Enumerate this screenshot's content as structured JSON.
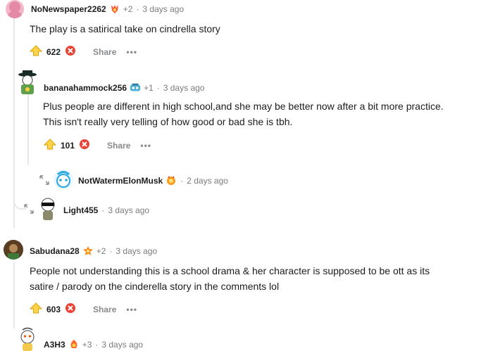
{
  "comments": [
    {
      "username": "NoNewspaper2262",
      "award_count": "+2",
      "time": "3 days ago",
      "body": "The play is a satirical take on cindrella story",
      "votes": "622",
      "share": "Share",
      "more": "•••"
    },
    {
      "username": "bananahammock256",
      "award_count": "+1",
      "time": "3 days ago",
      "body_line1": "Plus people are different in high school,and she may be better now after a bit more practice.",
      "body_line2": "This isn't really very telling of how good or bad she is tbh.",
      "votes": "101",
      "share": "Share",
      "more": "•••"
    },
    {
      "username": "NotWatermElonMusk",
      "time": "2 days ago"
    },
    {
      "username": "Light455",
      "time": "3 days ago"
    },
    {
      "username": "Sabudana28",
      "award_count": "+2",
      "time": "3 days ago",
      "body_line1": "People not understanding this is a school drama & her character is supposed to be ott as its",
      "body_line2": "satire / parody on the cinderella story in the comments lol",
      "votes": "603",
      "share": "Share",
      "more": "•••"
    },
    {
      "username": "A3H3",
      "award_count": "+3",
      "time": "3 days ago"
    }
  ],
  "colors": {
    "upvote": "#ff9a1e",
    "downvote_badge": "#ea4335",
    "muted": "#7c7c7c",
    "thread": "#e5e7e9"
  },
  "icons": {
    "upvote": "upvote-icon",
    "downvote": "downvote-icon",
    "expand": "expand-icon",
    "award": "award-icon"
  }
}
